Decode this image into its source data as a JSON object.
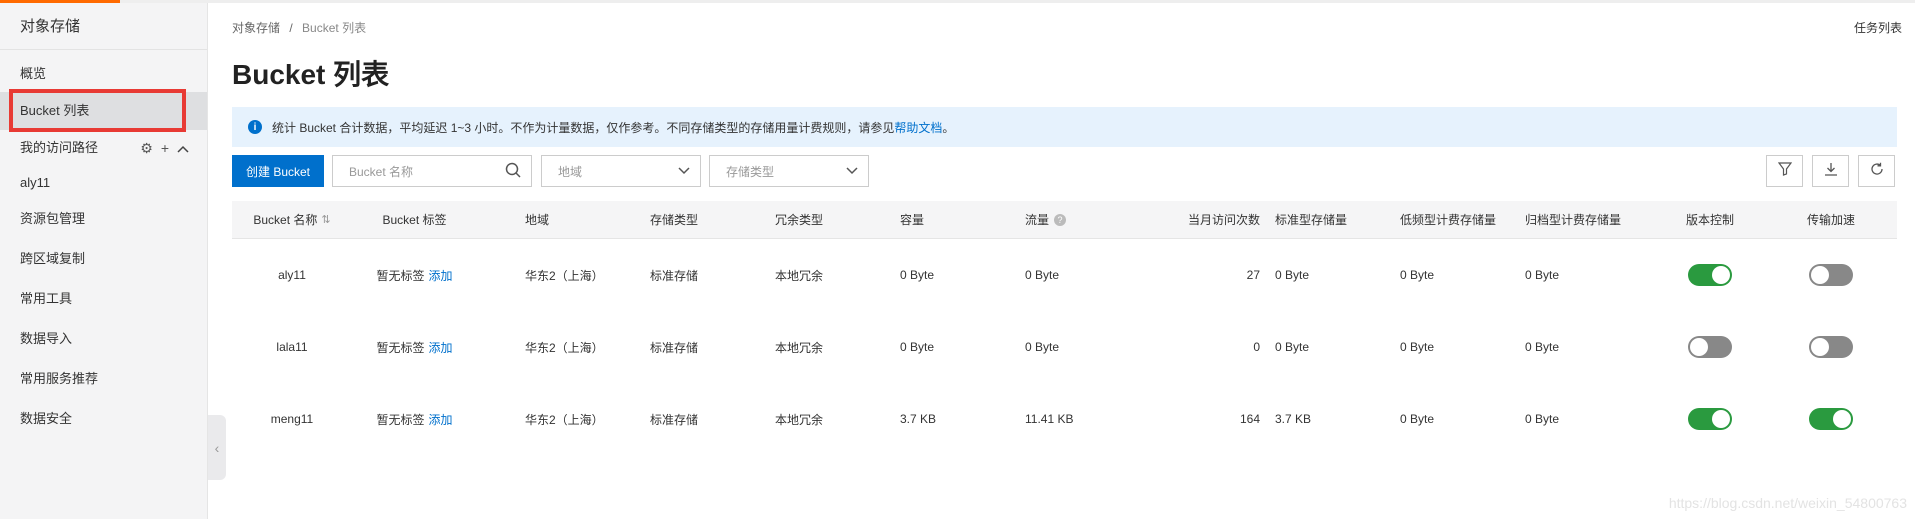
{
  "sidebar": {
    "title": "对象存储",
    "overview": "概览",
    "bucket_list": "Bucket 列表",
    "access_paths": "我的访问路径",
    "path_item": "aly11",
    "items": [
      "资源包管理",
      "跨区域复制",
      "常用工具",
      "数据导入",
      "常用服务推荐",
      "数据安全"
    ]
  },
  "breadcrumb": {
    "root": "对象存储",
    "sep": "/",
    "current": "Bucket 列表"
  },
  "task_list": "任务列表",
  "page_title": "Bucket 列表",
  "notice": {
    "text": "统计 Bucket 合计数据，平均延迟 1~3 小时。不作为计量数据，仅作参考。不同存储类型的存储用量计费规则，请参见",
    "link": "帮助文档",
    "tail": "。"
  },
  "toolbar": {
    "create": "创建 Bucket",
    "search_placeholder": "Bucket 名称",
    "region_placeholder": "地域",
    "storage_placeholder": "存储类型"
  },
  "columns": [
    "Bucket 名称",
    "Bucket 标签",
    "地域",
    "存储类型",
    "冗余类型",
    "容量",
    "流量",
    "当月访问次数",
    "标准型存储量",
    "低频型计费存储量",
    "归档型计费存储量",
    "版本控制",
    "传输加速"
  ],
  "rows": [
    {
      "name": "aly11",
      "tag": "暂无标签",
      "tag_add": "添加",
      "region": "华东2（上海）",
      "storage": "标准存储",
      "redundancy": "本地冗余",
      "capacity": "0 Byte",
      "traffic": "0 Byte",
      "visits": "27",
      "standard": "0 Byte",
      "ia": "0 Byte",
      "archive": "0 Byte",
      "versioning": true,
      "acceleration": false
    },
    {
      "name": "lala11",
      "tag": "暂无标签",
      "tag_add": "添加",
      "region": "华东2（上海）",
      "storage": "标准存储",
      "redundancy": "本地冗余",
      "capacity": "0 Byte",
      "traffic": "0 Byte",
      "visits": "0",
      "standard": "0 Byte",
      "ia": "0 Byte",
      "archive": "0 Byte",
      "versioning": false,
      "acceleration": false
    },
    {
      "name": "meng11",
      "tag": "暂无标签",
      "tag_add": "添加",
      "region": "华东2（上海）",
      "storage": "标准存储",
      "redundancy": "本地冗余",
      "capacity": "3.7 KB",
      "traffic": "11.41 KB",
      "visits": "164",
      "standard": "3.7 KB",
      "ia": "0 Byte",
      "archive": "0 Byte",
      "versioning": true,
      "acceleration": true
    }
  ],
  "watermark": "https://blog.csdn.net/weixin_54800763",
  "colors": {
    "accent": "#0070cc",
    "toggle_on": "#2a9a3f",
    "highlight": "#e83a34",
    "brand": "#ff6a00"
  }
}
